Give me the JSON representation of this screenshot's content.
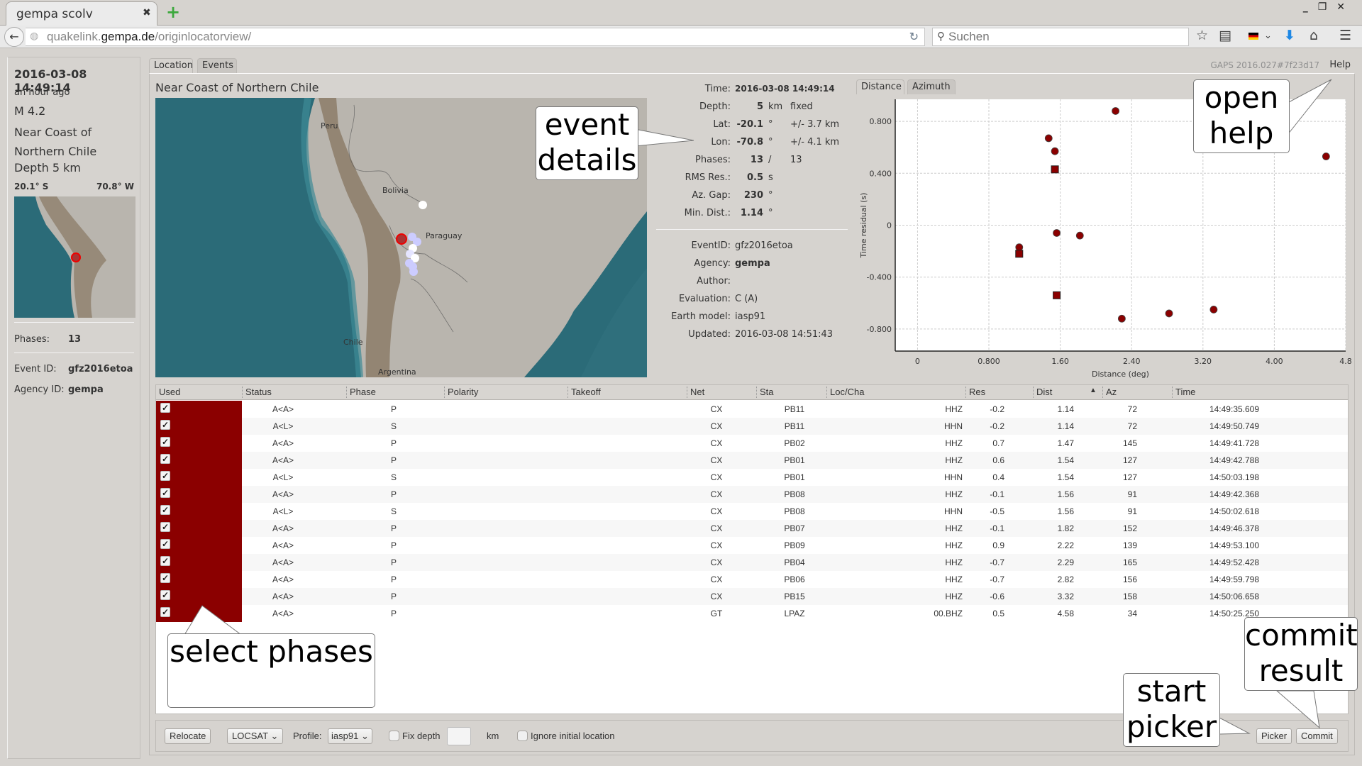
{
  "browser": {
    "tab_title": "gempa scolv",
    "tab_close": "✖",
    "new_tab": "+",
    "window_controls": "_ ▣ ✕",
    "url_prefix": "quakelink.",
    "url_domain": "gempa.de",
    "url_path": "/originlocatorview/",
    "search_placeholder": "Suchen",
    "icons": [
      "back-icon",
      "globe-icon",
      "reload-icon",
      "search-icon",
      "bookmark-star-icon",
      "reading-list-icon",
      "flag-de-icon",
      "chevron-down-icon",
      "download-icon",
      "home-icon",
      "menu-icon"
    ]
  },
  "left_panel": {
    "time": "2016-03-08 14:49:14",
    "ago": "an hour ago",
    "magnitude": "M 4.2",
    "region": "Near Coast of Northern Chile",
    "depth": "Depth 5 km",
    "lat": "20.1° S",
    "lon": "70.8° W",
    "phases_label": "Phases:",
    "phases_value": "13",
    "event_id_label": "Event ID:",
    "event_id_value": "gfz2016etoa",
    "agency_label": "Agency ID:",
    "agency_value": "gempa"
  },
  "main": {
    "tabs": [
      {
        "label": "Location",
        "active": true
      },
      {
        "label": "Events",
        "active": false
      }
    ],
    "version": "GAPS 2016.027#7f23d17",
    "help": "Help",
    "region_title": "Near Coast of Northern Chile",
    "map_labels": [
      "Peru",
      "Bolivia",
      "Paraguay",
      "Chile",
      "Argentina"
    ]
  },
  "details": {
    "rows": [
      {
        "label": "Time:",
        "value": "2016-03-08 14:49:14",
        "unit": "",
        "extra": ""
      },
      {
        "label": "Depth:",
        "value": "5",
        "unit": "km",
        "extra": "fixed"
      },
      {
        "label": "Lat:",
        "value": "-20.1",
        "unit": "°",
        "extra": "+/- 3.7 km"
      },
      {
        "label": "Lon:",
        "value": "-70.8",
        "unit": "°",
        "extra": "+/- 4.1 km"
      },
      {
        "label": "Phases:",
        "value": "13",
        "unit": "/",
        "extra": "13"
      },
      {
        "label": "RMS Res.:",
        "value": "0.5",
        "unit": "s",
        "extra": ""
      },
      {
        "label": "Az. Gap:",
        "value": "230",
        "unit": "°",
        "extra": ""
      },
      {
        "label": "Min. Dist.:",
        "value": "1.14",
        "unit": "°",
        "extra": ""
      }
    ],
    "meta": [
      {
        "label": "EventID:",
        "value": "gfz2016etoa"
      },
      {
        "label": "Agency:",
        "value": "gempa"
      },
      {
        "label": "Author:",
        "value": ""
      },
      {
        "label": "Evaluation:",
        "value": "C (A)"
      },
      {
        "label": "Earth model:",
        "value": "iasp91"
      },
      {
        "label": "Updated:",
        "value": "2016-03-08 14:51:43"
      }
    ]
  },
  "chart_tabs": [
    {
      "label": "Distance",
      "active": true
    },
    {
      "label": "Azimuth",
      "active": false
    }
  ],
  "chart_data": {
    "type": "scatter",
    "title": "",
    "xlabel": "Distance (deg)",
    "ylabel": "Time residual (s)",
    "xlim": [
      -0.25,
      4.8
    ],
    "ylim": [
      -0.97,
      0.97
    ],
    "xticks": [
      0,
      0.8,
      1.6,
      2.4,
      3.2,
      4.0,
      4.8
    ],
    "xtick_labels": [
      "0",
      "0.800",
      "1.60",
      "2.40",
      "3.20",
      "4.00",
      "4.8"
    ],
    "yticks": [
      0.8,
      0.4,
      0,
      -0.4,
      -0.8
    ],
    "ytick_labels": [
      "0.800",
      "0.400",
      "0",
      "-0.400",
      "-0.800"
    ],
    "grid": true,
    "color": "#8b0000",
    "series": [
      {
        "name": "P",
        "marker": "circle",
        "points": [
          [
            1.14,
            -0.17
          ],
          [
            1.47,
            0.67
          ],
          [
            1.54,
            0.57
          ],
          [
            1.56,
            -0.06
          ],
          [
            1.82,
            -0.08
          ],
          [
            2.22,
            0.88
          ],
          [
            2.29,
            -0.72
          ],
          [
            2.82,
            -0.68
          ],
          [
            3.32,
            -0.65
          ],
          [
            4.58,
            0.53
          ]
        ]
      },
      {
        "name": "S",
        "marker": "square",
        "points": [
          [
            1.14,
            -0.22
          ],
          [
            1.54,
            0.43
          ],
          [
            1.56,
            -0.54
          ]
        ]
      }
    ]
  },
  "table": {
    "columns": [
      "Used",
      "Status",
      "Phase",
      "Polarity",
      "Takeoff",
      "Net",
      "Sta",
      "Loc/Cha",
      "Res",
      "Dist",
      "Az",
      "Time"
    ],
    "sort_indicator": "▲",
    "rows": [
      {
        "used": true,
        "status": "A<A>",
        "phase": "P",
        "polarity": "",
        "takeoff": "",
        "net": "CX",
        "sta": "PB11",
        "loccha": "HHZ",
        "res": "-0.2",
        "dist": "1.14",
        "az": "72",
        "time": "14:49:35.609"
      },
      {
        "used": true,
        "status": "A<L>",
        "phase": "S",
        "polarity": "",
        "takeoff": "",
        "net": "CX",
        "sta": "PB11",
        "loccha": "HHN",
        "res": "-0.2",
        "dist": "1.14",
        "az": "72",
        "time": "14:49:50.749"
      },
      {
        "used": true,
        "status": "A<A>",
        "phase": "P",
        "polarity": "",
        "takeoff": "",
        "net": "CX",
        "sta": "PB02",
        "loccha": "HHZ",
        "res": "0.7",
        "dist": "1.47",
        "az": "145",
        "time": "14:49:41.728"
      },
      {
        "used": true,
        "status": "A<A>",
        "phase": "P",
        "polarity": "",
        "takeoff": "",
        "net": "CX",
        "sta": "PB01",
        "loccha": "HHZ",
        "res": "0.6",
        "dist": "1.54",
        "az": "127",
        "time": "14:49:42.788"
      },
      {
        "used": true,
        "status": "A<L>",
        "phase": "S",
        "polarity": "",
        "takeoff": "",
        "net": "CX",
        "sta": "PB01",
        "loccha": "HHN",
        "res": "0.4",
        "dist": "1.54",
        "az": "127",
        "time": "14:50:03.198"
      },
      {
        "used": true,
        "status": "A<A>",
        "phase": "P",
        "polarity": "",
        "takeoff": "",
        "net": "CX",
        "sta": "PB08",
        "loccha": "HHZ",
        "res": "-0.1",
        "dist": "1.56",
        "az": "91",
        "time": "14:49:42.368"
      },
      {
        "used": true,
        "status": "A<L>",
        "phase": "S",
        "polarity": "",
        "takeoff": "",
        "net": "CX",
        "sta": "PB08",
        "loccha": "HHN",
        "res": "-0.5",
        "dist": "1.56",
        "az": "91",
        "time": "14:50:02.618"
      },
      {
        "used": true,
        "status": "A<A>",
        "phase": "P",
        "polarity": "",
        "takeoff": "",
        "net": "CX",
        "sta": "PB07",
        "loccha": "HHZ",
        "res": "-0.1",
        "dist": "1.82",
        "az": "152",
        "time": "14:49:46.378"
      },
      {
        "used": true,
        "status": "A<A>",
        "phase": "P",
        "polarity": "",
        "takeoff": "",
        "net": "CX",
        "sta": "PB09",
        "loccha": "HHZ",
        "res": "0.9",
        "dist": "2.22",
        "az": "139",
        "time": "14:49:53.100"
      },
      {
        "used": true,
        "status": "A<A>",
        "phase": "P",
        "polarity": "",
        "takeoff": "",
        "net": "CX",
        "sta": "PB04",
        "loccha": "HHZ",
        "res": "-0.7",
        "dist": "2.29",
        "az": "165",
        "time": "14:49:52.428"
      },
      {
        "used": true,
        "status": "A<A>",
        "phase": "P",
        "polarity": "",
        "takeoff": "",
        "net": "CX",
        "sta": "PB06",
        "loccha": "HHZ",
        "res": "-0.7",
        "dist": "2.82",
        "az": "156",
        "time": "14:49:59.798"
      },
      {
        "used": true,
        "status": "A<A>",
        "phase": "P",
        "polarity": "",
        "takeoff": "",
        "net": "CX",
        "sta": "PB15",
        "loccha": "HHZ",
        "res": "-0.6",
        "dist": "3.32",
        "az": "158",
        "time": "14:50:06.658"
      },
      {
        "used": true,
        "status": "A<A>",
        "phase": "P",
        "polarity": "",
        "takeoff": "",
        "net": "GT",
        "sta": "LPAZ",
        "loccha": "00.BHZ",
        "res": "0.5",
        "dist": "4.58",
        "az": "34",
        "time": "14:50:25.250"
      }
    ]
  },
  "bottom_bar": {
    "relocate": "Relocate",
    "locator": "LOCSAT",
    "profile_label": "Profile:",
    "profile": "iasp91",
    "fix_depth": "Fix depth",
    "fix_depth_value": "",
    "km": "km",
    "ignore_initial": "Ignore initial location",
    "picker": "Picker",
    "commit": "Commit"
  },
  "callouts": {
    "event_details": "event details",
    "open_help": "open help",
    "select_phases": "select phases",
    "start_picker": "start picker",
    "commit_result": "commit result"
  },
  "colors": {
    "used_column": "#8b0000",
    "point": "#8b0000",
    "event_marker": "#d00000",
    "station_marker": "#ccccff",
    "ocean": "#2b6b78",
    "land": "#b9b5ae"
  }
}
